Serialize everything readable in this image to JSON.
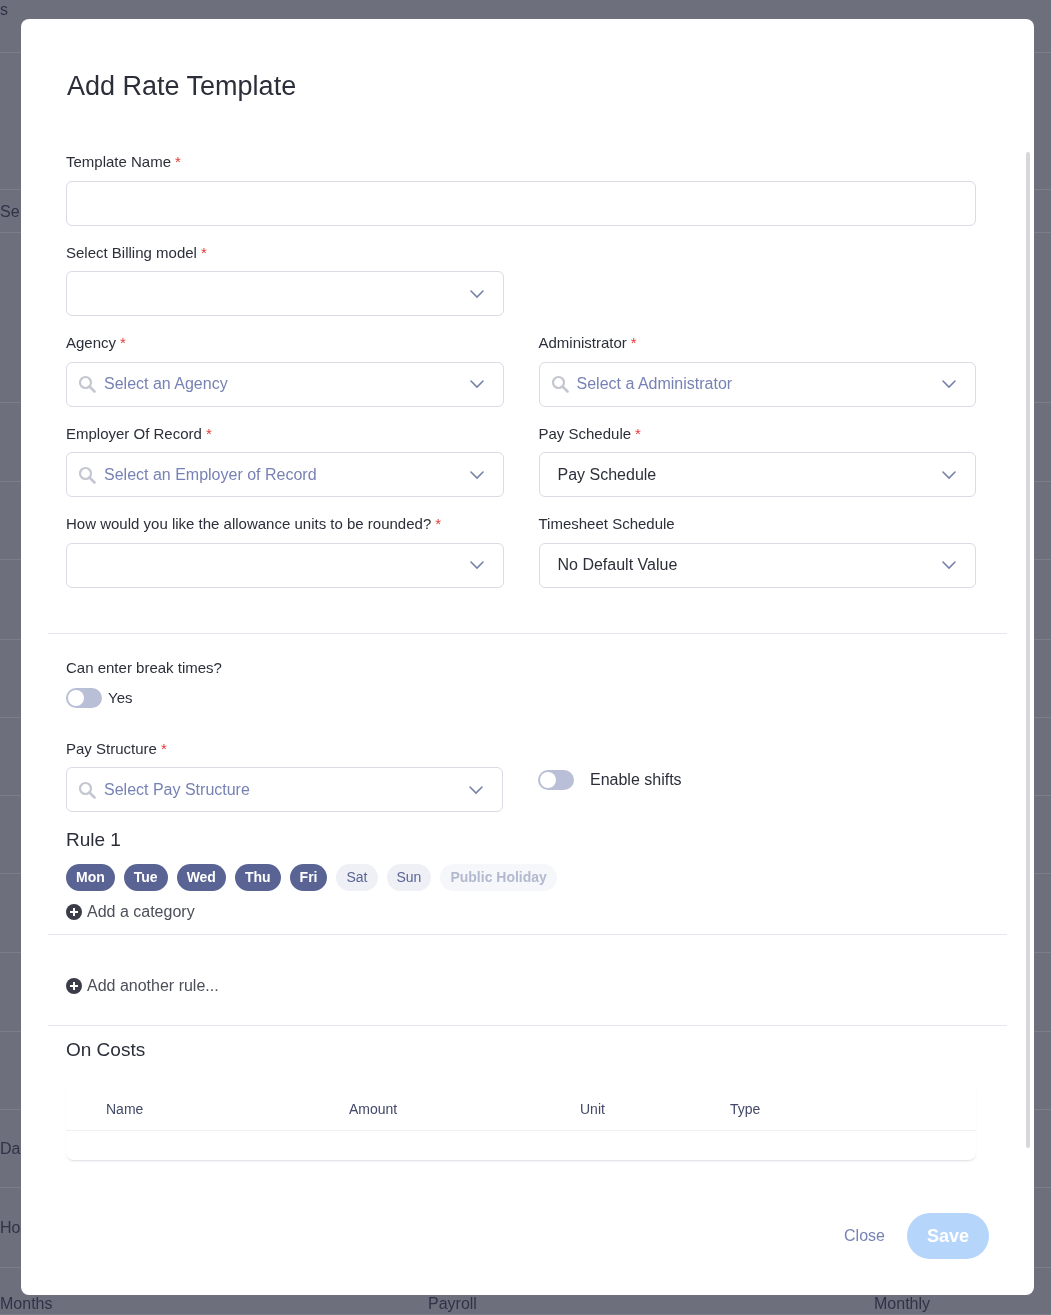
{
  "background": {
    "rows": [
      [
        "s"
      ],
      [
        "Se"
      ],
      [
        "Da"
      ],
      [
        "Ho"
      ],
      [
        "Months",
        "Payroll",
        "Monthly"
      ]
    ]
  },
  "dialog": {
    "title": "Add Rate Template",
    "template_name": {
      "label": "Template Name",
      "required_mark": "*",
      "kind": "text"
    },
    "billing_model": {
      "label": "Select Billing model",
      "required_mark": "*",
      "kind": "select"
    },
    "field_pairs": [
      [
        {
          "label": "Agency",
          "required_mark": "*",
          "kind": "search",
          "placeholder": "Select an Agency"
        },
        {
          "label": "Administrator",
          "required_mark": "*",
          "kind": "search",
          "placeholder": "Select a Administrator"
        }
      ],
      [
        {
          "label": "Employer Of Record",
          "required_mark": "*",
          "kind": "search",
          "placeholder": "Select an Employer of Record"
        },
        {
          "label": "Pay Schedule",
          "required_mark": "*",
          "kind": "select",
          "value": "Pay Schedule"
        }
      ],
      [
        {
          "label": "How would you like the allowance units to be rounded?",
          "required_mark": "*",
          "kind": "select"
        },
        {
          "label": "Timesheet Schedule",
          "kind": "select",
          "value": "No Default Value"
        }
      ]
    ],
    "break_times": {
      "label": "Can enter break times?",
      "toggle_label": "Yes",
      "on": false
    },
    "pay_structure": {
      "label": "Pay Structure",
      "required_mark": "*",
      "kind": "search",
      "placeholder": "Select Pay Structure"
    },
    "enable_shifts": {
      "label": "Enable shifts",
      "on": false
    },
    "rule": {
      "title": "Rule 1",
      "days": [
        {
          "label": "Mon",
          "selected": true,
          "disabled": false
        },
        {
          "label": "Tue",
          "selected": true,
          "disabled": false
        },
        {
          "label": "Wed",
          "selected": true,
          "disabled": false
        },
        {
          "label": "Thu",
          "selected": true,
          "disabled": false
        },
        {
          "label": "Fri",
          "selected": true,
          "disabled": false
        },
        {
          "label": "Sat",
          "selected": false,
          "disabled": false
        },
        {
          "label": "Sun",
          "selected": false,
          "disabled": false
        },
        {
          "label": "Public Holiday",
          "selected": false,
          "disabled": true
        }
      ],
      "add_category": "Add a category"
    },
    "add_rule": "Add another rule...",
    "on_costs": {
      "title": "On Costs",
      "columns": [
        "Name",
        "Amount",
        "Unit",
        "Type"
      ]
    },
    "buttons": {
      "close": "Close",
      "save": {
        "label": "Save",
        "disabled": true
      }
    }
  }
}
